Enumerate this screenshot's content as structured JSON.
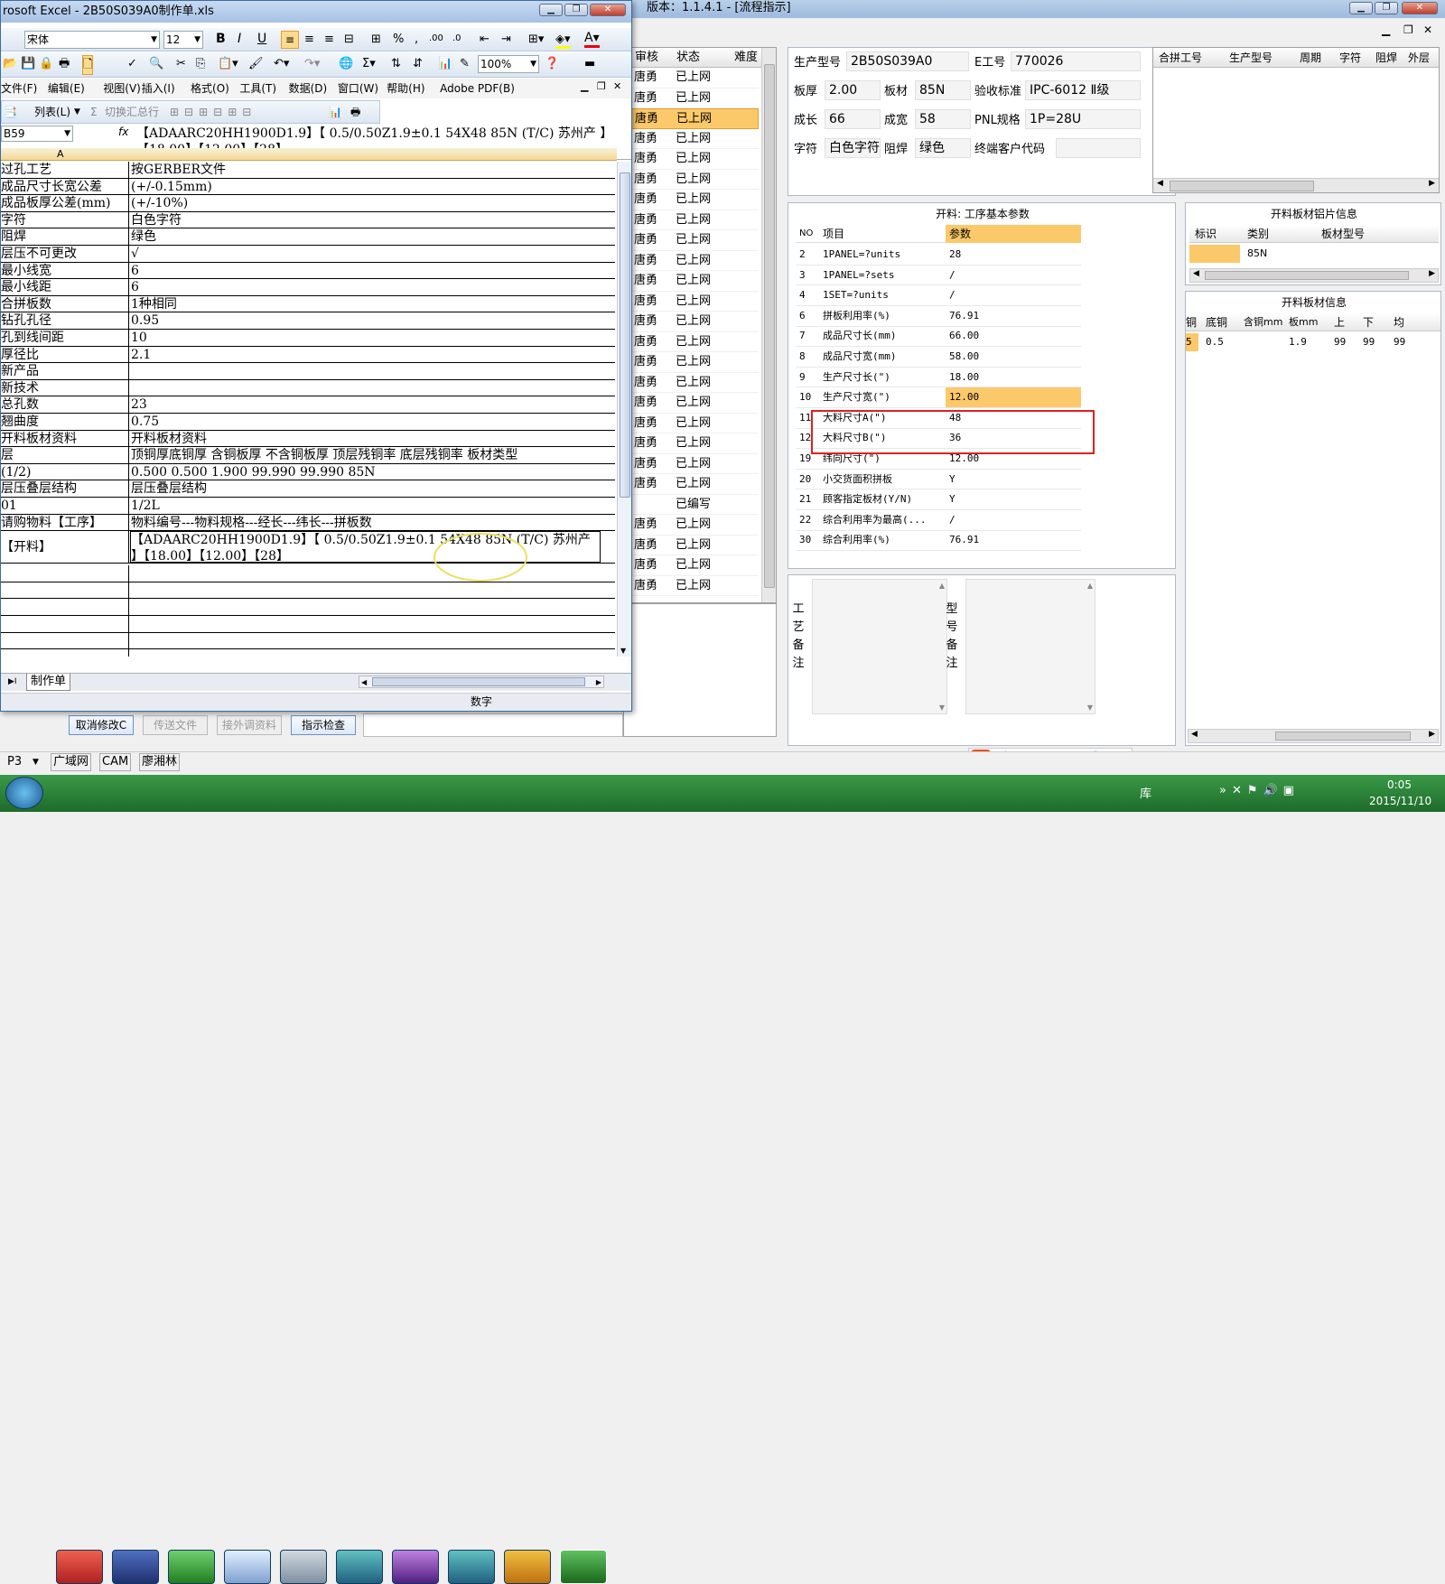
{
  "excel": {
    "title": "rosoft Excel - 2B50S039A0制作单.xls",
    "font": "宋体",
    "size": "12",
    "zoom": "100%",
    "menu": [
      "文件(F)",
      "编辑(E)",
      "视图(V)",
      "插入(I)",
      "格式(O)",
      "工具(T)",
      "数据(D)",
      "窗口(W)",
      "帮助(H)",
      "Adobe PDF(B)"
    ],
    "toolbar3": {
      "list": "列表(L)",
      "summary": "切换汇总行"
    },
    "namebox": "B59",
    "fx": "fx",
    "formula": "【ADAARC20HH1900D1.9】【 0.5/0.50Z1.9±0.1 54X48  85N (T/C) 苏州产 】【18.00】【12.00】【28】",
    "col_a": "A",
    "rows": [
      {
        "a": "过孔工艺",
        "b": "按GERBER文件"
      },
      {
        "a": "成品尺寸长宽公差",
        "b": "(+/-0.15mm)"
      },
      {
        "a": "成品板厚公差(mm)",
        "b": "(+/-10%)"
      },
      {
        "a": "字符",
        "b": "白色字符"
      },
      {
        "a": "阻焊",
        "b": "绿色"
      },
      {
        "a": "层压不可更改",
        "b": "√"
      },
      {
        "a": "最小线宽",
        "b": "6"
      },
      {
        "a": "最小线距",
        "b": "6"
      },
      {
        "a": "合拼板数",
        "b": "1种相同"
      },
      {
        "a": "钻孔孔径",
        "b": "0.95"
      },
      {
        "a": "孔到线间距",
        "b": "10"
      },
      {
        "a": "厚径比",
        "b": "2.1"
      },
      {
        "a": "新产品",
        "b": ""
      },
      {
        "a": "新技术",
        "b": ""
      },
      {
        "a": "总孔数",
        "b": "23"
      },
      {
        "a": "翘曲度",
        "b": "0.75"
      },
      {
        "a": "开料板材资料",
        "b": "开料板材资料"
      },
      {
        "a": "层",
        "b": "顶铜厚底铜厚 含铜板厚 不含铜板厚 顶层残铜率 底层残铜率 板材类型"
      },
      {
        "a": "(1/2)",
        "b": "0.500  0.500        1.900      99.990     99.990     85N"
      },
      {
        "a": "层压叠层结构",
        "b": "层压叠层结构"
      },
      {
        "a": "01",
        "b": "1/2L"
      },
      {
        "a": "请购物料【工序】",
        "b": "物料编号---物料规格---经长---纬长---拼板数"
      }
    ],
    "kailiao_label": "【开料】",
    "kailiao_line1": "【ADAARC20HH1900D1.9】【 0.5/0.50Z1.9±0.1 54X48  85N (T/C) 苏州产",
    "kailiao_line2": "】【18.00】【12.00】【28】",
    "sheet_tab": "制作单",
    "status": "数字"
  },
  "app": {
    "title": "版本：1.1.4.1 - [流程指示]",
    "status_header": [
      "审核",
      "状态",
      "难度"
    ],
    "status_rows": [
      {
        "n": "唐勇",
        "s": "已上网"
      },
      {
        "n": "唐勇",
        "s": "已上网"
      },
      {
        "n": "唐勇",
        "s": "已上网",
        "sel": true
      },
      {
        "n": "唐勇",
        "s": "已上网"
      },
      {
        "n": "唐勇",
        "s": "已上网"
      },
      {
        "n": "唐勇",
        "s": "已上网"
      },
      {
        "n": "唐勇",
        "s": "已上网"
      },
      {
        "n": "唐勇",
        "s": "已上网"
      },
      {
        "n": "唐勇",
        "s": "已上网"
      },
      {
        "n": "唐勇",
        "s": "已上网"
      },
      {
        "n": "唐勇",
        "s": "已上网"
      },
      {
        "n": "唐勇",
        "s": "已上网"
      },
      {
        "n": "唐勇",
        "s": "已上网"
      },
      {
        "n": "唐勇",
        "s": "已上网"
      },
      {
        "n": "唐勇",
        "s": "已上网"
      },
      {
        "n": "唐勇",
        "s": "已上网"
      },
      {
        "n": "唐勇",
        "s": "已上网"
      },
      {
        "n": "唐勇",
        "s": "已上网"
      },
      {
        "n": "唐勇",
        "s": "已上网"
      },
      {
        "n": "唐勇",
        "s": "已上网"
      },
      {
        "n": "唐勇",
        "s": "已上网"
      },
      {
        "n": "",
        "s": "已编写"
      },
      {
        "n": "唐勇",
        "s": "已上网"
      },
      {
        "n": "唐勇",
        "s": "已上网"
      },
      {
        "n": "唐勇",
        "s": "已上网"
      },
      {
        "n": "唐勇",
        "s": "已上网"
      }
    ],
    "info": {
      "l1": "生产型号",
      "v1": "2B50S039A0",
      "l2": "E工号",
      "v2": "770026",
      "l3": "板厚",
      "v3": "2.00",
      "l4": "板材",
      "v4": "85N",
      "l5": "验收标准",
      "v5": "IPC-6012 Ⅱ级",
      "l6": "成长",
      "v6": "66",
      "l7": "成宽",
      "v7": "58",
      "l8": "PNL规格",
      "v8": "1P=28U",
      "l9": "字符",
      "v9": "白色字符",
      "l10": "阻焊",
      "v10": "绿色",
      "l11": "终端客户代码",
      "v11": ""
    },
    "merge_header": [
      "合拼工号",
      "生产型号",
      "周期",
      "字符",
      "阻焊",
      "外层"
    ],
    "params_title": "开料: 工序基本参数",
    "params_header": [
      "NO",
      "项目",
      "参数"
    ],
    "params": [
      {
        "no": "2",
        "item": "1PANEL=?units",
        "val": "28"
      },
      {
        "no": "3",
        "item": "1PANEL=?sets",
        "val": "/"
      },
      {
        "no": "4",
        "item": "1SET=?units",
        "val": "/"
      },
      {
        "no": "6",
        "item": "拼板利用率(%)",
        "val": "76.91"
      },
      {
        "no": "7",
        "item": "成品尺寸长(mm)",
        "val": "66.00"
      },
      {
        "no": "8",
        "item": "成品尺寸宽(mm)",
        "val": "58.00"
      },
      {
        "no": "9",
        "item": "生产尺寸长(\")",
        "val": "18.00"
      },
      {
        "no": "10",
        "item": "生产尺寸宽(\")",
        "val": "12.00",
        "sel": true
      },
      {
        "no": "11",
        "item": "大料尺寸A(\")",
        "val": "48"
      },
      {
        "no": "12",
        "item": "大料尺寸B(\")",
        "val": "36"
      },
      {
        "no": "19",
        "item": "纬向尺寸(\")",
        "val": "12.00"
      },
      {
        "no": "20",
        "item": "小交货面积拼板",
        "val": "Y"
      },
      {
        "no": "21",
        "item": "顾客指定板材(Y/N)",
        "val": "Y"
      },
      {
        "no": "22",
        "item": "综合利用率为最高(...",
        "val": "/"
      },
      {
        "no": "30",
        "item": "综合利用率(%)",
        "val": "76.91"
      }
    ],
    "sheet_info": {
      "title": "开料板材铝片信息",
      "header": [
        "标识",
        "类别",
        "板材型号"
      ],
      "row": [
        "",
        "85N",
        ""
      ]
    },
    "board_info": {
      "title": "开料板材信息",
      "header": [
        "铜",
        "底铜",
        "含铜mm",
        "板mm",
        "上",
        "下",
        "均"
      ],
      "row": [
        "5",
        "0.5",
        "",
        "1.9",
        "99",
        "99",
        "99"
      ]
    },
    "remark1": "工艺备注",
    "remark2": "型号备注",
    "buttons": [
      "取消修改C",
      "传送文件",
      "接外调资料",
      "指示检查"
    ],
    "status": [
      "P3",
      "广域网",
      "CAM",
      "廖湘林"
    ]
  },
  "taskbar": {
    "lang": "库",
    "time": "0:05",
    "date": "2015/11/10"
  },
  "colors": {
    "accent": "#fcc96a",
    "taskbar": "#1e6b2a",
    "highlight_box": "#e02020",
    "circle": "#e8e060"
  }
}
